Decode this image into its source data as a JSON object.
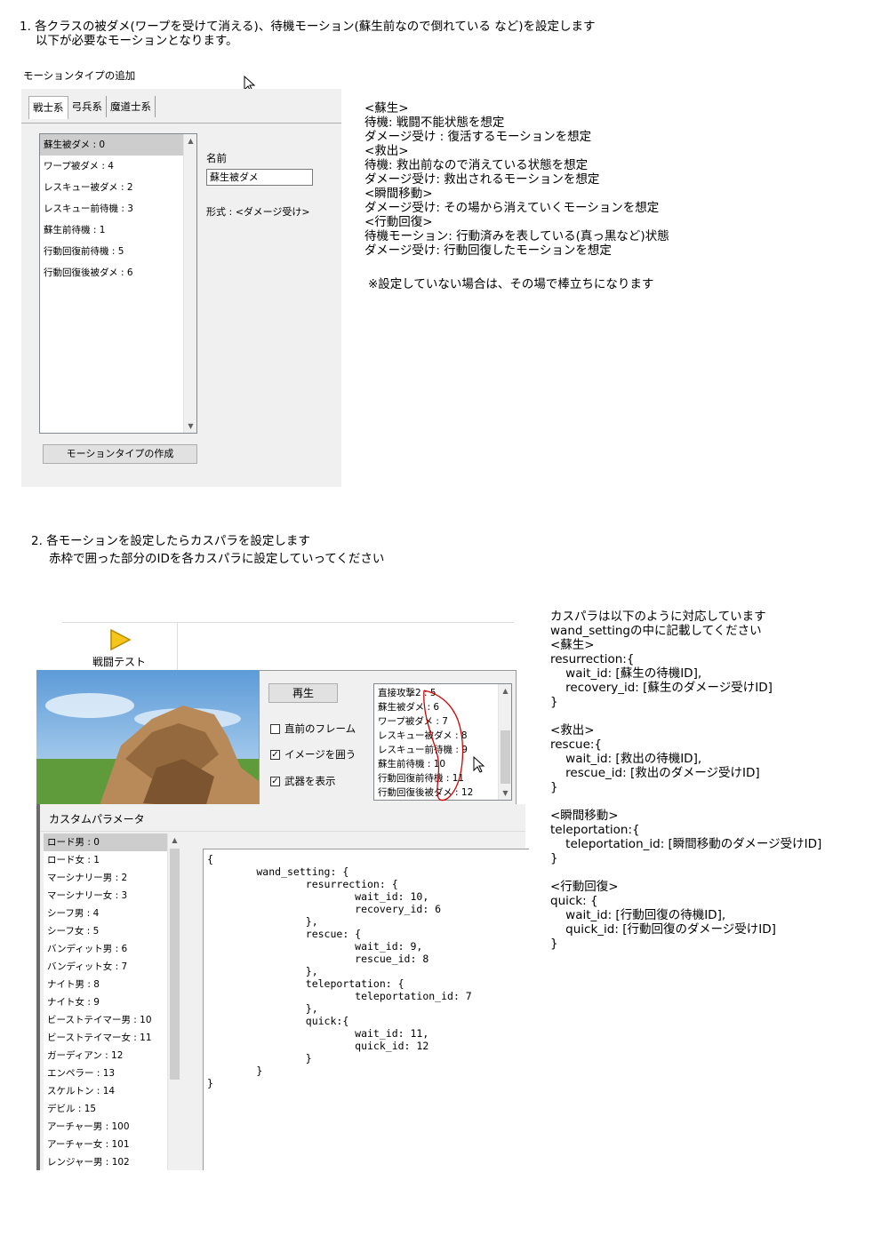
{
  "step1": {
    "line1": "1. 各クラスの被ダメ(ワープを受けて消える)、待機モーション(蘇生前なので倒れている など)を設定します",
    "line2": "以下が必要なモーションとなります。"
  },
  "panel1": {
    "title": "モーションタイプの追加",
    "tabs": [
      "戦士系",
      "弓兵系",
      "魔道士系"
    ],
    "list_items": [
      "蘇生被ダメ : 0",
      "ワープ被ダメ : 4",
      "レスキュー被ダメ : 2",
      "レスキュー前待機 : 3",
      "蘇生前待機 : 1",
      "行動回復前待機 : 5",
      "行動回復後被ダメ : 6"
    ],
    "name_label": "名前",
    "name_value": "蘇生被ダメ",
    "format_label": "形式 : <ダメージ受け>",
    "create_button": "モーションタイプの作成"
  },
  "notes1": [
    "<蘇生>",
    "待機: 戦闘不能状態を想定",
    "ダメージ受け : 復活するモーションを想定",
    "<救出>",
    "待機: 救出前なので消えている状態を想定",
    "ダメージ受け: 救出されるモーションを想定",
    "<瞬間移動>",
    "ダメージ受け: その場から消えていくモーションを想定",
    "<行動回復>",
    "待機モーション: 行動済みを表している(真っ黒など)状態",
    "ダメージ受け: 行動回復したモーションを想定"
  ],
  "notes1_footer": "※設定していない場合は、その場で棒立ちになります",
  "step2": {
    "line1": "2. 各モーションを設定したらカスパラを設定します",
    "line2": "赤枠で囲った部分のIDを各カスパラに設定していってください"
  },
  "toolbar": {
    "battle_test": "戦闘テスト"
  },
  "control": {
    "play_button": "再生",
    "checkboxes": [
      {
        "label": "直前のフレーム",
        "checked": false
      },
      {
        "label": "イメージを囲う",
        "checked": true
      },
      {
        "label": "武器を表示",
        "checked": true
      }
    ],
    "motion_list": [
      "直接攻撃2 : 5",
      "蘇生被ダメ : 6",
      "ワープ被ダメ : 7",
      "レスキュー被ダメ : 8",
      "レスキュー前待機 : 9",
      "蘇生前待機 : 10",
      "行動回復前待機 : 11",
      "行動回復後被ダメ : 12"
    ]
  },
  "custom_param": {
    "title": "カスタムパラメータ",
    "class_list": [
      "ロード男 : 0",
      "ロード女 : 1",
      "マーシナリー男 : 2",
      "マーシナリー女 : 3",
      "シーフ男 : 4",
      "シーフ女 : 5",
      "バンディット男 : 6",
      "バンディット女 : 7",
      "ナイト男 : 8",
      "ナイト女 : 9",
      "ビーストテイマー男 : 10",
      "ビーストテイマー女 : 11",
      "ガーディアン : 12",
      "エンペラー : 13",
      "スケルトン : 14",
      "デビル : 15",
      "アーチャー男 : 100",
      "アーチャー女 : 101",
      "レンジャー男 : 102"
    ],
    "code": "{\n        wand_setting: {\n                resurrection: {\n                        wait_id: 10,\n                        recovery_id: 6\n                },\n                rescue: {\n                        wait_id: 9,\n                        rescue_id: 8\n                },\n                teleportation: {\n                        teleportation_id: 7\n                },\n                quick:{\n                        wait_id: 11,\n                        quick_id: 12\n                }\n        }\n}"
  },
  "notes2": {
    "lines": [
      "カスパラは以下のように対応しています",
      "wand_settingの中に記載してください",
      "<蘇生>",
      "resurrection:{",
      "    wait_id: [蘇生の待機ID],",
      "    recovery_id: [蘇生のダメージ受けID]",
      "}",
      "",
      "<救出>",
      "rescue:{",
      "    wait_id: [救出の待機ID],",
      "    rescue_id: [救出のダメージ受けID]",
      "}",
      "",
      "<瞬間移動>",
      "teleportation:{",
      "    teleportation_id: [瞬間移動のダメージ受けID]",
      "}",
      "",
      "<行動回復>",
      "quick: {",
      "    wait_id: [行動回復の待機ID],",
      "    quick_id: [行動回復のダメージ受けID]",
      "}"
    ]
  },
  "colors": {
    "annotation_red": "#d40000",
    "selection_gray": "#cdcdcd",
    "panel_bg": "#f0f0f0"
  }
}
